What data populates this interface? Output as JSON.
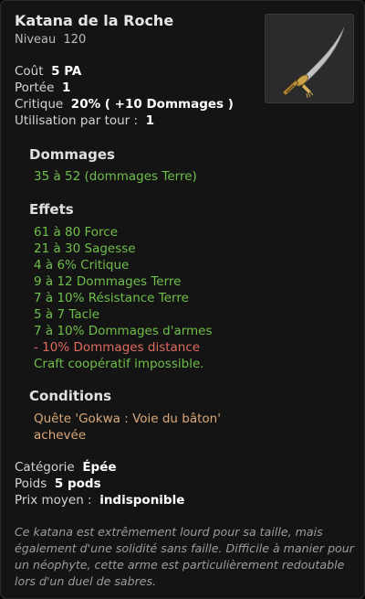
{
  "item": {
    "name": "Katana de la Roche",
    "level_label": "Niveau",
    "level_value": "120"
  },
  "stats": {
    "cost_label": "Coût",
    "cost_value": "5 PA",
    "range_label": "Portée",
    "range_value": "1",
    "critical_label": "Critique",
    "critical_value": "20% ( +10 Dommages )",
    "uses_label": "Utilisation par tour :",
    "uses_value": "1"
  },
  "damage": {
    "title": "Dommages",
    "line": "35 à 52 (dommages Terre)"
  },
  "effects": {
    "title": "Effets",
    "items": [
      {
        "text": "61 à 80 Force",
        "type": "positive"
      },
      {
        "text": "21 à 30 Sagesse",
        "type": "positive"
      },
      {
        "text": "4 à 6% Critique",
        "type": "positive"
      },
      {
        "text": "9 à 12 Dommages Terre",
        "type": "positive"
      },
      {
        "text": "7 à 10% Résistance Terre",
        "type": "positive"
      },
      {
        "text": "5 à 7 Tacle",
        "type": "positive"
      },
      {
        "text": "7 à 10% Dommages d'armes",
        "type": "positive"
      },
      {
        "text": "- 10% Dommages distance",
        "type": "negative"
      },
      {
        "text": "Craft coopératif impossible.",
        "type": "positive"
      }
    ]
  },
  "conditions": {
    "title": "Conditions",
    "text": "Quête 'Gokwa : Voie du bâton' achevée"
  },
  "info": {
    "category_label": "Catégorie",
    "category_value": "Épée",
    "weight_label": "Poids",
    "weight_value": "5 pods",
    "price_label": "Prix moyen :",
    "price_value": "indisponible"
  },
  "description": "Ce katana est extrêmement lourd pour sa taille, mais également d'une solidité sans faille. Difficile à manier pour un néophyte, cette arme est particulièrement redoutable lors d'un duel de sabres.",
  "colors": {
    "positive": "#6fbf4a",
    "negative": "#e06a5f",
    "condition": "#d9a87a",
    "background": "#141414"
  },
  "icons": {
    "item_image": "katana-icon"
  }
}
